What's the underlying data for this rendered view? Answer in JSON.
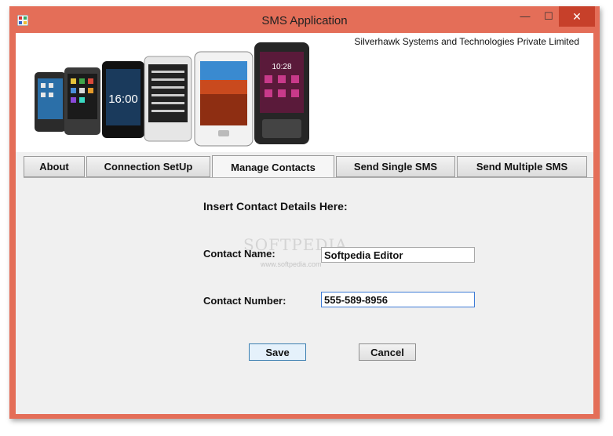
{
  "window": {
    "title": "SMS Application",
    "close_glyph": "✕",
    "maximize_glyph": "☐",
    "minimize_glyph": "—"
  },
  "header": {
    "company": "Silverhawk Systems and Technologies Private Limited",
    "phone_clock": "16:00",
    "phone_clock_2": "10:28"
  },
  "tabs": [
    {
      "label": "About",
      "active": false
    },
    {
      "label": "Connection SetUp",
      "active": false
    },
    {
      "label": "Manage Contacts",
      "active": true
    },
    {
      "label": "Send Single SMS",
      "active": false
    },
    {
      "label": "Send Multiple SMS",
      "active": false
    }
  ],
  "form": {
    "heading": "Insert Contact Details Here:",
    "name_label": "Contact Name:",
    "name_value": "Softpedia Editor",
    "number_label": "Contact Number:",
    "number_value": "555-589-8956"
  },
  "buttons": {
    "save": "Save",
    "cancel": "Cancel"
  },
  "watermark": {
    "text": "SOFTPEDIA",
    "url": "www.softpedia.com"
  },
  "colors": {
    "frame": "#e46e58",
    "close": "#c7402a",
    "save_focus": "#3c7fb1"
  }
}
